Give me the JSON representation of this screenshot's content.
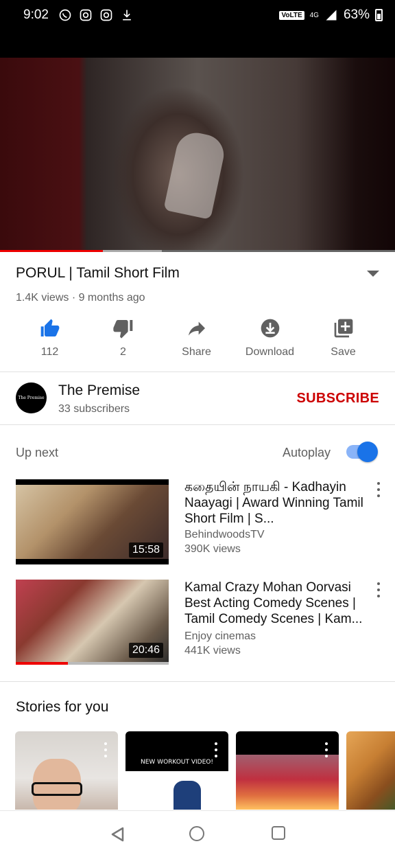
{
  "status_bar": {
    "time": "9:02",
    "volte": "VoLTE",
    "network": "4G",
    "battery": "63%"
  },
  "player": {
    "played_fraction": 0.26,
    "buffered_fraction": 0.41
  },
  "video": {
    "title": "PORUL | Tamil Short Film",
    "meta": "1.4K views · 9 months ago"
  },
  "actions": {
    "like": "112",
    "dislike": "2",
    "share": "Share",
    "download": "Download",
    "save": "Save"
  },
  "channel": {
    "avatar_text": "The Premise",
    "name": "The Premise",
    "subscribers": "33 subscribers",
    "subscribe_label": "SUBSCRIBE"
  },
  "up_next": {
    "label": "Up next",
    "autoplay_label": "Autoplay",
    "autoplay_on": true,
    "items": [
      {
        "title": "கதையின் நாயகி - Kadhayin Naayagi | Award Winning Tamil Short Film | S...",
        "channel": "BehindwoodsTV",
        "views": "390K views",
        "duration": "15:58"
      },
      {
        "title": "Kamal Crazy Mohan Oorvasi Best Acting Comedy Scenes | Tamil Comedy Scenes | Kam...",
        "channel": "Enjoy cinemas",
        "views": "441K views",
        "duration": "20:46",
        "watched_fraction": 0.34
      }
    ]
  },
  "stories": {
    "title": "Stories for you",
    "items": [
      {
        "caption": ""
      },
      {
        "caption": "NEW WORKOUT VIDEO!"
      },
      {
        "caption": ""
      },
      {
        "caption": ""
      }
    ]
  },
  "colors": {
    "accent_red": "#cc0000",
    "like_blue": "#1a73e8",
    "secondary_text": "#606060"
  }
}
